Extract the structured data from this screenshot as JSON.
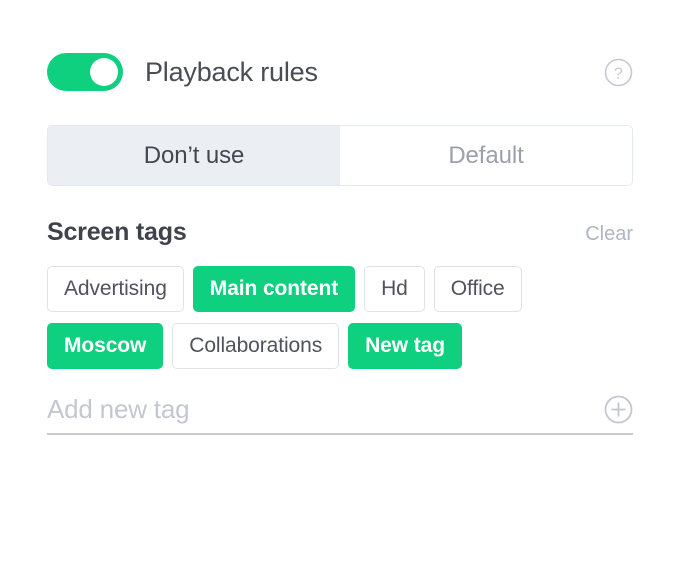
{
  "header": {
    "title": "Playback rules",
    "toggle_state": "on",
    "help_icon": "question-circle-icon"
  },
  "mode_tabs": {
    "selected": "Don’t use",
    "items": [
      {
        "label": "Don’t use",
        "active": true
      },
      {
        "label": "Default",
        "active": false
      }
    ]
  },
  "screen_tags": {
    "title": "Screen tags",
    "clear_label": "Clear",
    "rows": [
      [
        {
          "label": "Advertising",
          "selected": false
        },
        {
          "label": "Main content",
          "selected": true
        },
        {
          "label": "Hd",
          "selected": false
        },
        {
          "label": "Office",
          "selected": false
        }
      ],
      [
        {
          "label": "Moscow",
          "selected": true
        },
        {
          "label": "Collaborations",
          "selected": false
        },
        {
          "label": "New tag",
          "selected": true
        }
      ]
    ]
  },
  "add_tag": {
    "value": "",
    "placeholder": "Add new tag",
    "add_icon": "plus-circle-icon"
  },
  "colors": {
    "accent_green": "#0ed07e",
    "tab_active_bg": "#ebeff4",
    "tag_border": "#dfe3e8",
    "muted_text": "#b0b6bf"
  }
}
